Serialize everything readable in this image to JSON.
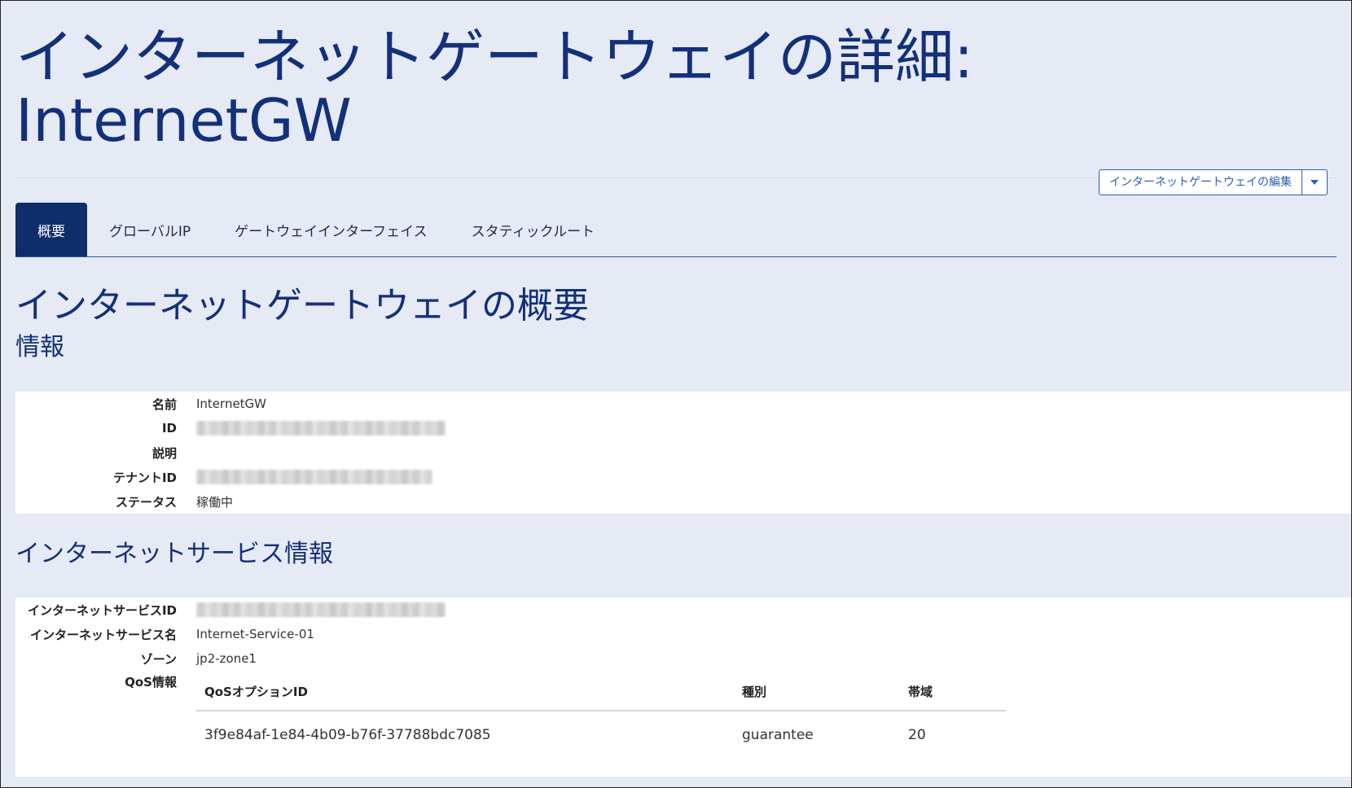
{
  "page": {
    "title_line1": "インターネットゲートウェイの詳細:",
    "title_line2": "InternetGW"
  },
  "actions": {
    "edit_label": "インターネットゲートウェイの編集"
  },
  "tabs": [
    {
      "label": "概要",
      "active": true
    },
    {
      "label": "グローバルIP",
      "active": false
    },
    {
      "label": "ゲートウェイインターフェイス",
      "active": false
    },
    {
      "label": "スタティックルート",
      "active": false
    }
  ],
  "overview": {
    "title": "インターネットゲートウェイの概要",
    "info_title": "情報",
    "info": {
      "name_label": "名前",
      "name_value": "InternetGW",
      "id_label": "ID",
      "description_label": "説明",
      "tenant_id_label": "テナントID",
      "status_label": "ステータス",
      "status_value": "稼働中"
    },
    "service_title": "インターネットサービス情報",
    "service": {
      "service_id_label": "インターネットサービスID",
      "service_name_label": "インターネットサービス名",
      "service_name_value": "Internet-Service-01",
      "zone_label": "ゾーン",
      "zone_value": "jp2-zone1",
      "qos_label": "QoS情報",
      "qos_table": {
        "headers": [
          "QoSオプションID",
          "種別",
          "帯域"
        ],
        "rows": [
          [
            "3f9e84af-1e84-4b09-b76f-37788bdc7085",
            "guarantee",
            "20"
          ]
        ]
      }
    }
  },
  "colors": {
    "background": "#e6eaf4",
    "heading": "#13307a",
    "active_tab": "#0f2d6b",
    "accent": "#2b5fb3"
  },
  "icons": {
    "dropdown": "caret-down-icon"
  }
}
